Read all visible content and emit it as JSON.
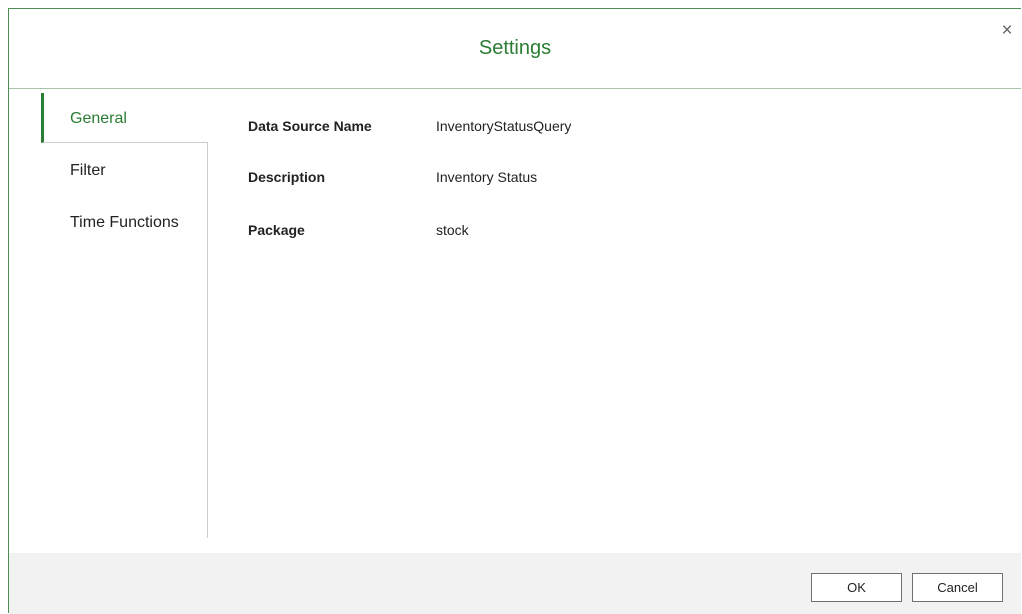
{
  "dialog": {
    "title": "Settings",
    "close_symbol": "×",
    "accent_color": "#2a7d33"
  },
  "sidebar": {
    "items": [
      {
        "label": "General",
        "active": true
      },
      {
        "label": "Filter",
        "active": false
      },
      {
        "label": "Time Functions",
        "active": false
      }
    ]
  },
  "general": {
    "fields": [
      {
        "label": "Data Source Name",
        "value": "InventoryStatusQuery"
      },
      {
        "label": "Description",
        "value": "Inventory Status"
      },
      {
        "label": "Package",
        "value": "stock"
      }
    ]
  },
  "footer": {
    "ok_label": "OK",
    "cancel_label": "Cancel"
  }
}
